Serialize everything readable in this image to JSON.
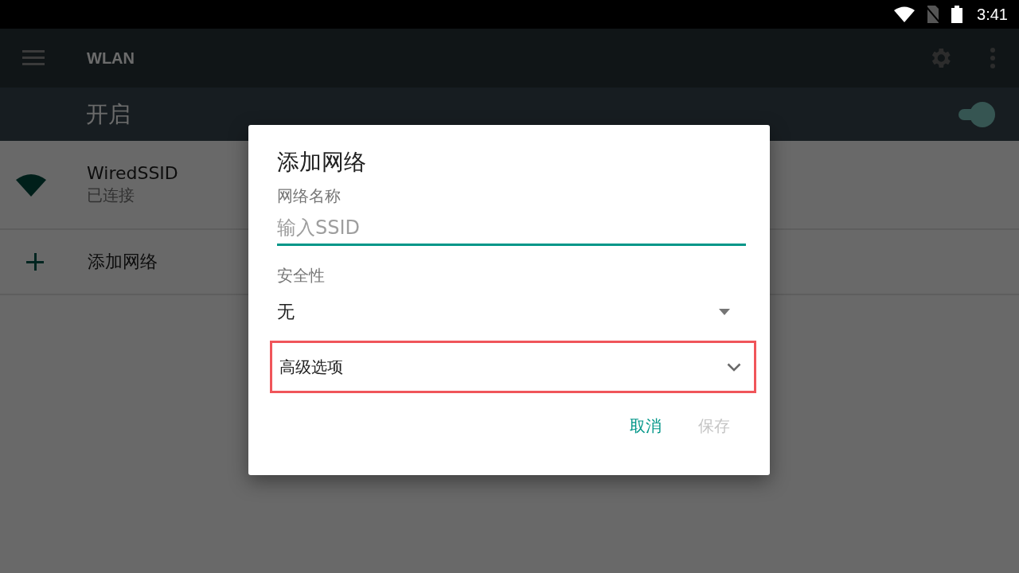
{
  "status_bar": {
    "time": "3:41"
  },
  "toolbar": {
    "title": "WLAN"
  },
  "master_switch": {
    "label": "开启",
    "on": true
  },
  "networks": [
    {
      "kind": "wifi",
      "name": "WiredSSID",
      "status": "已连接"
    },
    {
      "kind": "add",
      "name": "添加网络"
    }
  ],
  "dialog": {
    "title": "添加网络",
    "ssid_label": "网络名称",
    "ssid_placeholder": "输入SSID",
    "security_label": "安全性",
    "security_value": "无",
    "advanced": {
      "label": "高级选项",
      "highlighted": true
    },
    "buttons": [
      {
        "label": "取消",
        "disabled": false
      },
      {
        "label": "保存",
        "disabled": true
      }
    ]
  }
}
